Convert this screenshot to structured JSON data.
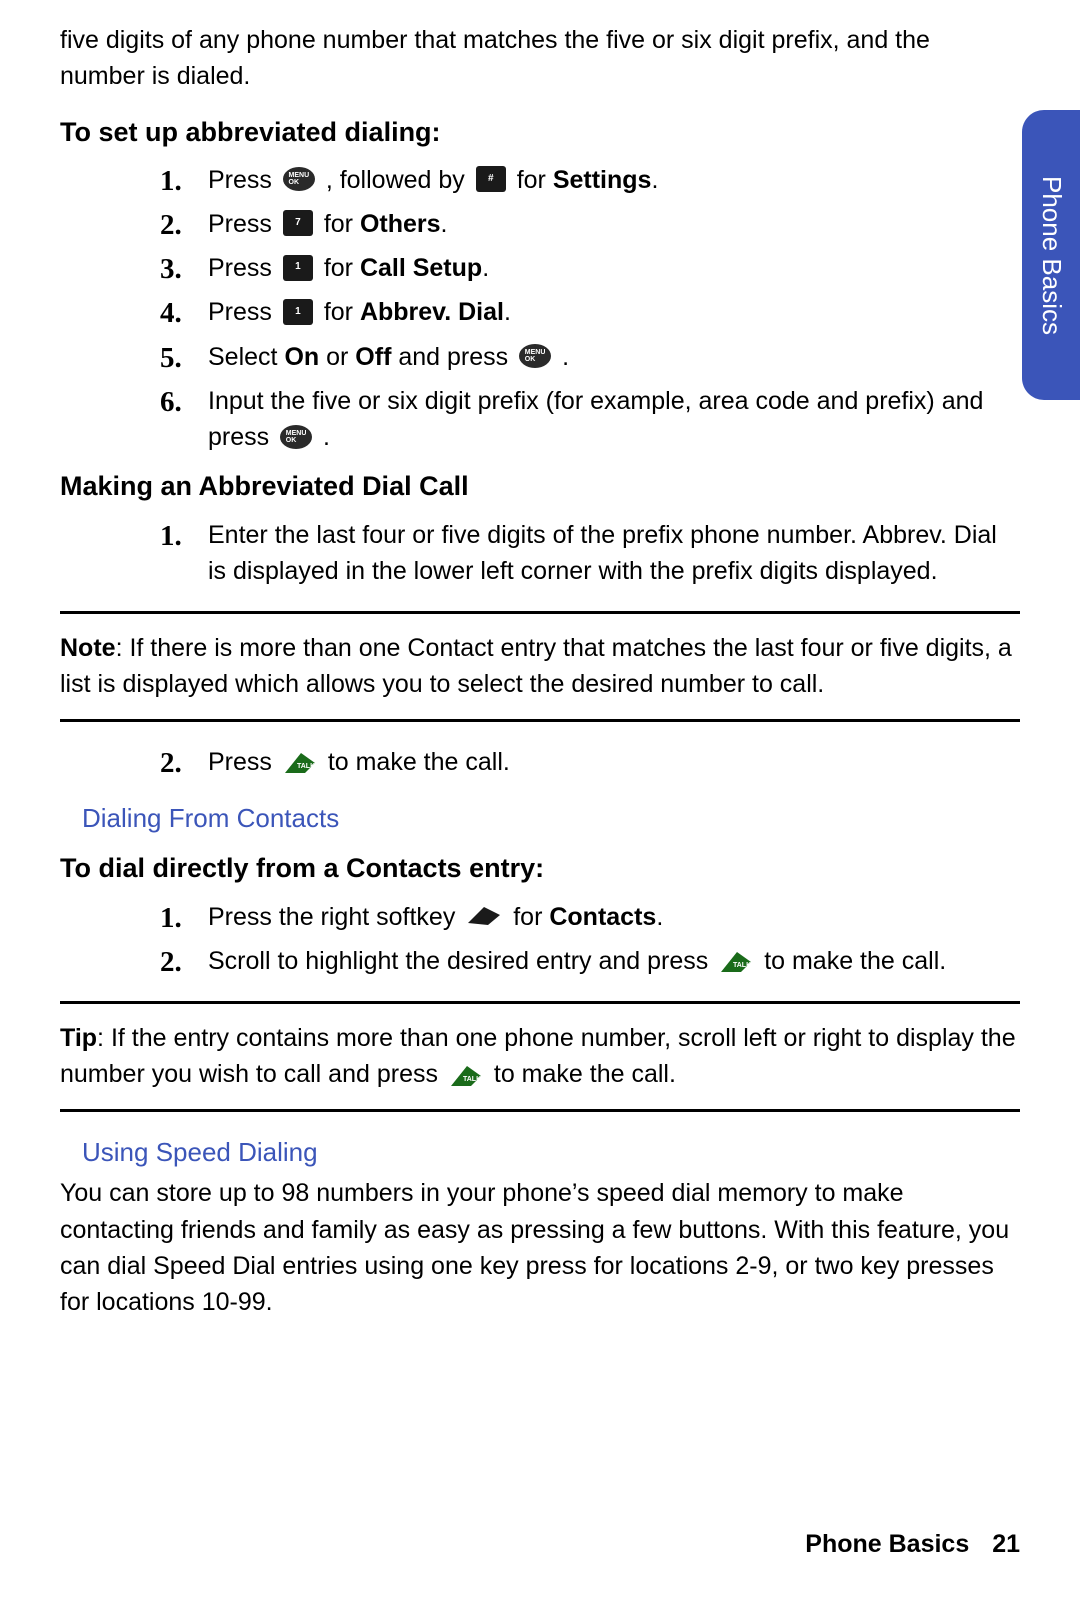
{
  "sideTab": "Phone Basics",
  "intro": "five digits of any phone number that matches the five or six digit prefix, and the number is dialed.",
  "h_setup": "To set up abbreviated dialing:",
  "setup": [
    {
      "n": "1.",
      "a": "Press ",
      "b": ", followed by ",
      "c": " for ",
      "d": "Settings",
      "e": "."
    },
    {
      "n": "2.",
      "a": "Press ",
      "c": " for ",
      "d": "Others",
      "e": "."
    },
    {
      "n": "3.",
      "a": "Press ",
      "c": " for ",
      "d": "Call Setup",
      "e": "."
    },
    {
      "n": "4.",
      "a": "Press ",
      "c": " for ",
      "d": "Abbrev. Dial",
      "e": "."
    },
    {
      "n": "5.",
      "a": "Select ",
      "on": "On",
      "or": " or ",
      "off": "Off",
      "b": " and press ",
      "e": "."
    },
    {
      "n": "6.",
      "a": "Input the five or six digit prefix (for example, area code and prefix) and press ",
      "e": "."
    }
  ],
  "h_making": "Making an Abbreviated Dial Call",
  "making_1_n": "1.",
  "making_1": "Enter the last four or five digits of the prefix phone number. Abbrev. Dial is displayed in the lower left corner with the prefix digits displayed.",
  "note_label": "Note",
  "note_body": ": If there is more than one Contact entry that matches the last four or five digits, a list is displayed which allows you to select the desired number to call.",
  "making_2_n": "2.",
  "making_2_a": "Press ",
  "making_2_b": " to make the call.",
  "sect_contacts": "Dialing From Contacts",
  "h_dial": "To dial directly from a Contacts entry:",
  "dial_1_n": "1.",
  "dial_1_a": "Press the right softkey ",
  "dial_1_b": " for ",
  "dial_1_c": "Contacts",
  "dial_1_d": ".",
  "dial_2_n": "2.",
  "dial_2_a": "Scroll to highlight the desired entry and press ",
  "dial_2_b": " to make the call.",
  "tip_label": "Tip",
  "tip_a": ": If the entry contains more than one phone number, scroll left or right to display the number you wish to call and press ",
  "tip_b": " to make the call.",
  "sect_speed": "Using Speed Dialing",
  "speed_body": "You can store up to 98 numbers in your phone’s speed dial memory to make contacting friends and family as easy as pressing a few buttons. With this feature, you can dial Speed Dial entries using one key press for locations 2-9, or two key presses for locations 10-99.",
  "footer_section": "Phone Basics",
  "footer_page": "21"
}
